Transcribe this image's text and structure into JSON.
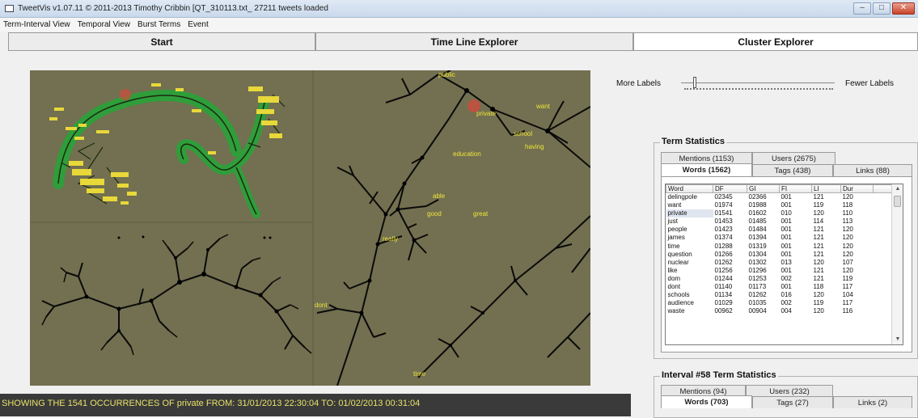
{
  "window": {
    "title": "TweetVis v1.07.11 © 2011-2013 Timothy Cribbin [QT_310113.txt_ 27211 tweets loaded",
    "minimize": "–",
    "maximize": "□",
    "close": "✕"
  },
  "menu": [
    "Term-Interval View",
    "Temporal View",
    "Burst Terms",
    "Event"
  ],
  "tabs": [
    {
      "label": "Start"
    },
    {
      "label": "Time Line Explorer"
    },
    {
      "label": "Cluster Explorer"
    }
  ],
  "labels_control": {
    "more": "More Labels",
    "fewer": "Fewer Labels",
    "level": 0.08
  },
  "viz": {
    "background": "#727050",
    "node_labels": [
      "public",
      "private",
      "want",
      "school",
      "having",
      "education",
      "able",
      "good",
      "great",
      "really",
      "time",
      "dont"
    ]
  },
  "term_statistics": {
    "title": "Term Statistics",
    "tabs_row1": [
      "Mentions (1153)",
      "Users (2675)"
    ],
    "tabs_row2": [
      "Words (1562)",
      "Tags (438)",
      "Links (88)"
    ],
    "columns": [
      "Word",
      "DF",
      "GI",
      "FI",
      "LI",
      "Dur"
    ],
    "rows": [
      [
        "delingpole",
        "02345",
        "02366",
        "001",
        "121",
        "120"
      ],
      [
        "want",
        "01974",
        "01988",
        "001",
        "119",
        "118"
      ],
      [
        "private",
        "01541",
        "01602",
        "010",
        "120",
        "110"
      ],
      [
        "just",
        "01453",
        "01485",
        "001",
        "114",
        "113"
      ],
      [
        "people",
        "01423",
        "01484",
        "001",
        "121",
        "120"
      ],
      [
        "james",
        "01374",
        "01394",
        "001",
        "121",
        "120"
      ],
      [
        "time",
        "01288",
        "01319",
        "001",
        "121",
        "120"
      ],
      [
        "question",
        "01266",
        "01304",
        "001",
        "121",
        "120"
      ],
      [
        "nuclear",
        "01262",
        "01302",
        "013",
        "120",
        "107"
      ],
      [
        "like",
        "01256",
        "01296",
        "001",
        "121",
        "120"
      ],
      [
        "dom",
        "01244",
        "01253",
        "002",
        "121",
        "119"
      ],
      [
        "dont",
        "01140",
        "01173",
        "001",
        "118",
        "117"
      ],
      [
        "schools",
        "01134",
        "01262",
        "016",
        "120",
        "104"
      ],
      [
        "audience",
        "01029",
        "01035",
        "002",
        "119",
        "117"
      ],
      [
        "waste",
        "00962",
        "00904",
        "004",
        "120",
        "116"
      ]
    ],
    "selected_word": "private"
  },
  "interval_statistics": {
    "title": "Interval #58 Term Statistics",
    "tabs_row1": [
      "Mentions (94)",
      "Users (232)"
    ],
    "tabs_row2": [
      "Words (703)",
      "Tags (27)",
      "Links (2)"
    ]
  },
  "status": {
    "text": "SHOWING THE 1541 OCCURRENCES OF private FROM: 31/01/2013 22:30:04 TO: 01/02/2013 00:31:04"
  }
}
